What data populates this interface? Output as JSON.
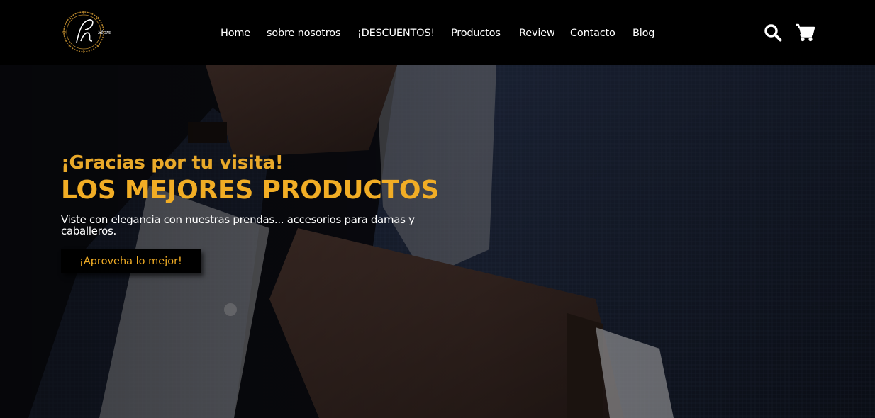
{
  "brand": {
    "logo_text": "PL Store",
    "logo_script": "PL",
    "logo_sub": "Store",
    "accent_color": "#f1ad25"
  },
  "nav": {
    "items": [
      {
        "label": "Home"
      },
      {
        "label": "sobre nosotros"
      },
      {
        "label": "¡DESCUENTOS!"
      },
      {
        "label": "Productos"
      },
      {
        "label": "Review"
      },
      {
        "label": "Contacto"
      },
      {
        "label": "Blog"
      }
    ],
    "icons": {
      "search": "search-icon",
      "cart": "cart-icon"
    }
  },
  "hero": {
    "greeting": "¡Gracias por tu visita!",
    "title": "LOS MEJORES PRODUCTOS",
    "description": "Viste con elegancia con nuestras prendas... accesorios para damas y caballeros.",
    "cta_label": "¡Aproveha lo mejor!"
  }
}
